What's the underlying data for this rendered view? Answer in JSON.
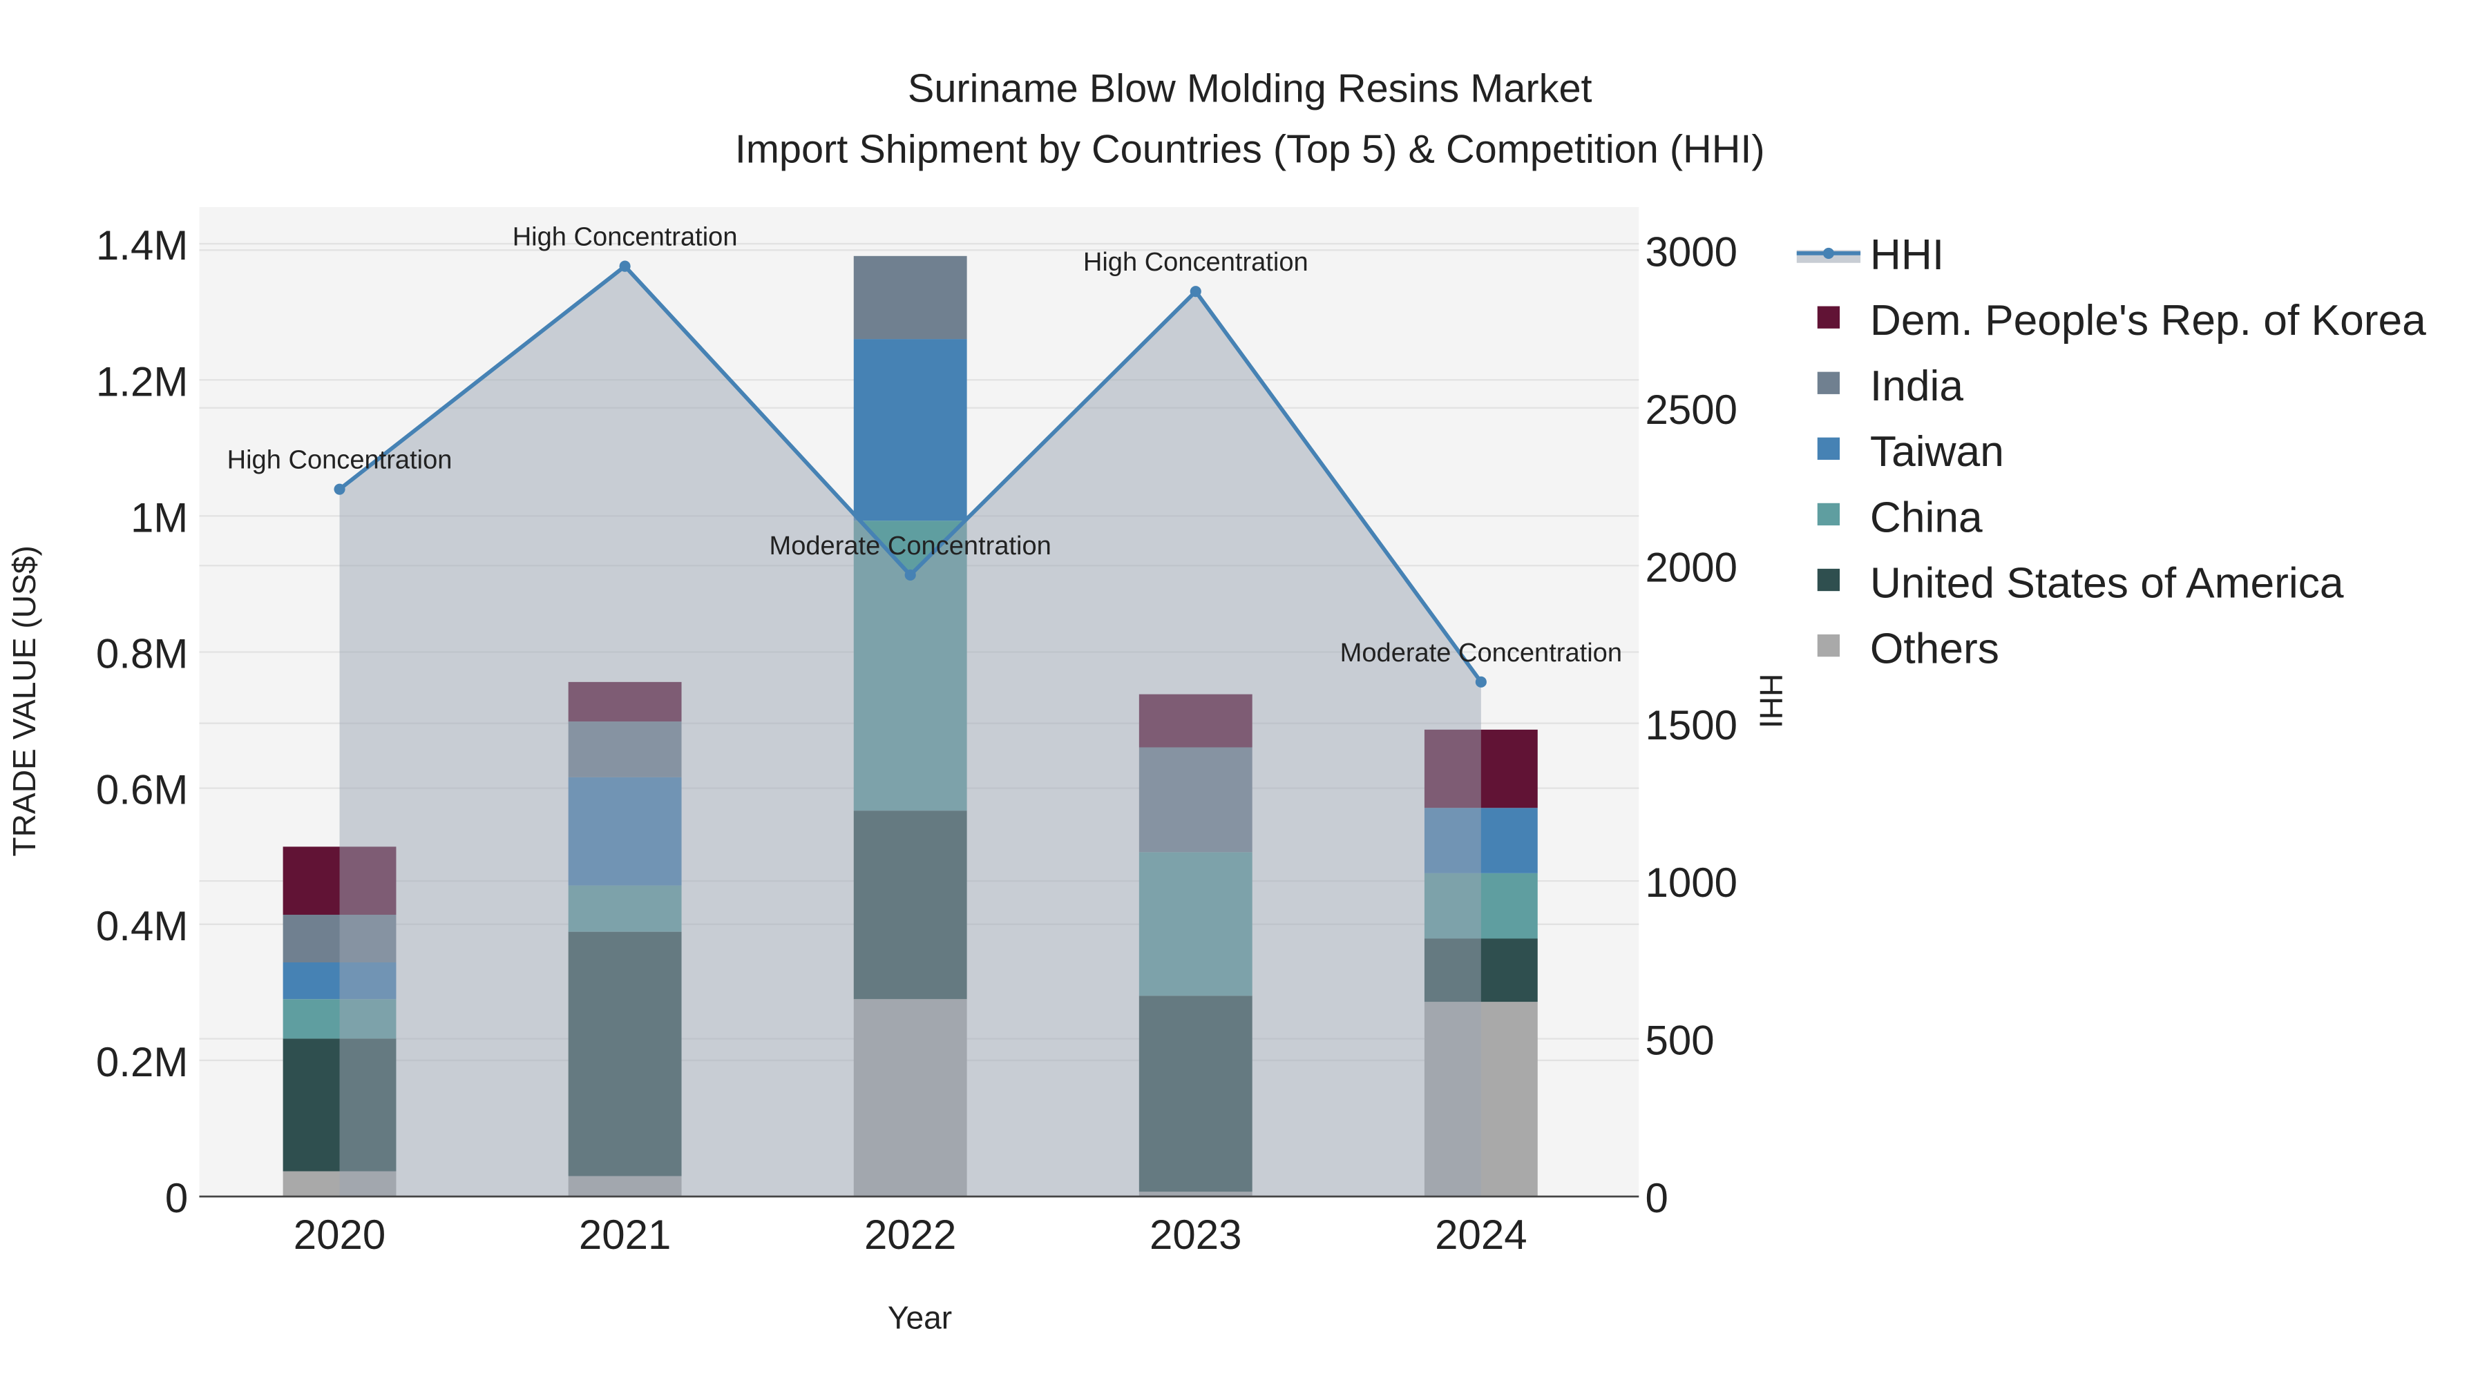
{
  "chart_data": {
    "type": "bar",
    "title": "Suriname Blow Molding Resins Market",
    "subtitle": "Import Shipment by Countries (Top 5) & Competition (HHI)",
    "xlabel": "Year",
    "ylabel": "TRADE VALUE (US$)",
    "y2label": "HHI",
    "categories": [
      "2020",
      "2021",
      "2022",
      "2023",
      "2024"
    ],
    "ylim": [
      0,
      1450000
    ],
    "y2lim": [
      0,
      3100
    ],
    "yticks": [
      {
        "v": 0,
        "label": "0"
      },
      {
        "v": 200000,
        "label": "0.2M"
      },
      {
        "v": 400000,
        "label": "0.4M"
      },
      {
        "v": 600000,
        "label": "0.6M"
      },
      {
        "v": 800000,
        "label": "0.8M"
      },
      {
        "v": 1000000,
        "label": "1M"
      },
      {
        "v": 1200000,
        "label": "1.2M"
      },
      {
        "v": 1400000,
        "label": "1.4M"
      }
    ],
    "y2ticks": [
      {
        "v": 0,
        "label": "0"
      },
      {
        "v": 500,
        "label": "500"
      },
      {
        "v": 1000,
        "label": "1000"
      },
      {
        "v": 1500,
        "label": "1500"
      },
      {
        "v": 2000,
        "label": "2000"
      },
      {
        "v": 2500,
        "label": "2500"
      },
      {
        "v": 3000,
        "label": "3000"
      }
    ],
    "stacked": true,
    "series": [
      {
        "name": "Others",
        "color": "#a9a9a9",
        "values": [
          37000,
          30000,
          290000,
          7000,
          286000
        ]
      },
      {
        "name": "United States of America",
        "color": "#2f4f4f",
        "values": [
          195000,
          359000,
          277000,
          288000,
          93000
        ]
      },
      {
        "name": "China",
        "color": "#5f9ea0",
        "values": [
          58000,
          68000,
          426000,
          211000,
          96000
        ]
      },
      {
        "name": "Taiwan",
        "color": "#4682b4",
        "values": [
          54000,
          159000,
          267000,
          0,
          96000
        ]
      },
      {
        "name": "India",
        "color": "#708090",
        "values": [
          70000,
          82000,
          122000,
          154000,
          0
        ]
      },
      {
        "name": "Dem. People's Rep. of Korea",
        "color": "#611335",
        "values": [
          100000,
          58000,
          0,
          78000,
          115000
        ]
      }
    ],
    "line": {
      "name": "HHI",
      "color": "#4682b4",
      "values": [
        2242,
        2949,
        1970,
        2869,
        1631
      ],
      "annotations": [
        "High Concentration",
        "High Concentration",
        "Moderate Concentration",
        "High Concentration",
        "Moderate Concentration"
      ]
    },
    "legend_order": [
      "HHI",
      "Dem. People's Rep. of Korea",
      "India",
      "Taiwan",
      "China",
      "United States of America",
      "Others"
    ],
    "legend_position": "right",
    "grid": true
  }
}
